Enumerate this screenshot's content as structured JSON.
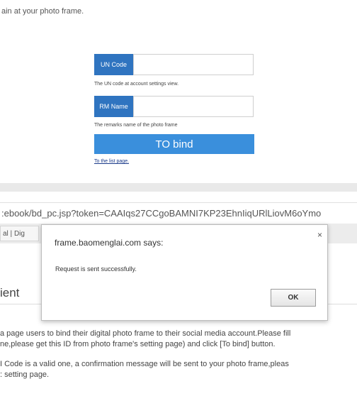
{
  "background_page": {
    "intro_line_1": "ain at your photo frame.",
    "un_code": {
      "label": "UN Code",
      "value": "",
      "hint": "The UN code at account settings view."
    },
    "rm_name": {
      "label": "RM Name",
      "value": "",
      "hint": "The remarks name of the photo frame"
    },
    "bind_button": "TO bind",
    "list_link": "To the list page."
  },
  "browser": {
    "url": ":ebook/bd_pc.jsp?token=CAAIqs27CCgoBAMNI7KP23EhnIiqURlLiovM6oYmo",
    "tab_label": "al | Dig"
  },
  "page": {
    "heading_fragment": "ient",
    "paragraphs": [
      "a page users to bind their digital photo frame to their social media account.Please fill",
      "ne,please get this ID from photo frame's setting page) and click [To bind] button.",
      "I Code is a valid one, a confirmation message will be sent to your photo frame,pleas",
      ": setting page."
    ]
  },
  "dialog": {
    "title": "frame.baomenglai.com says:",
    "close_glyph": "×",
    "message": "Request is sent successfully.",
    "ok_label": "OK"
  }
}
